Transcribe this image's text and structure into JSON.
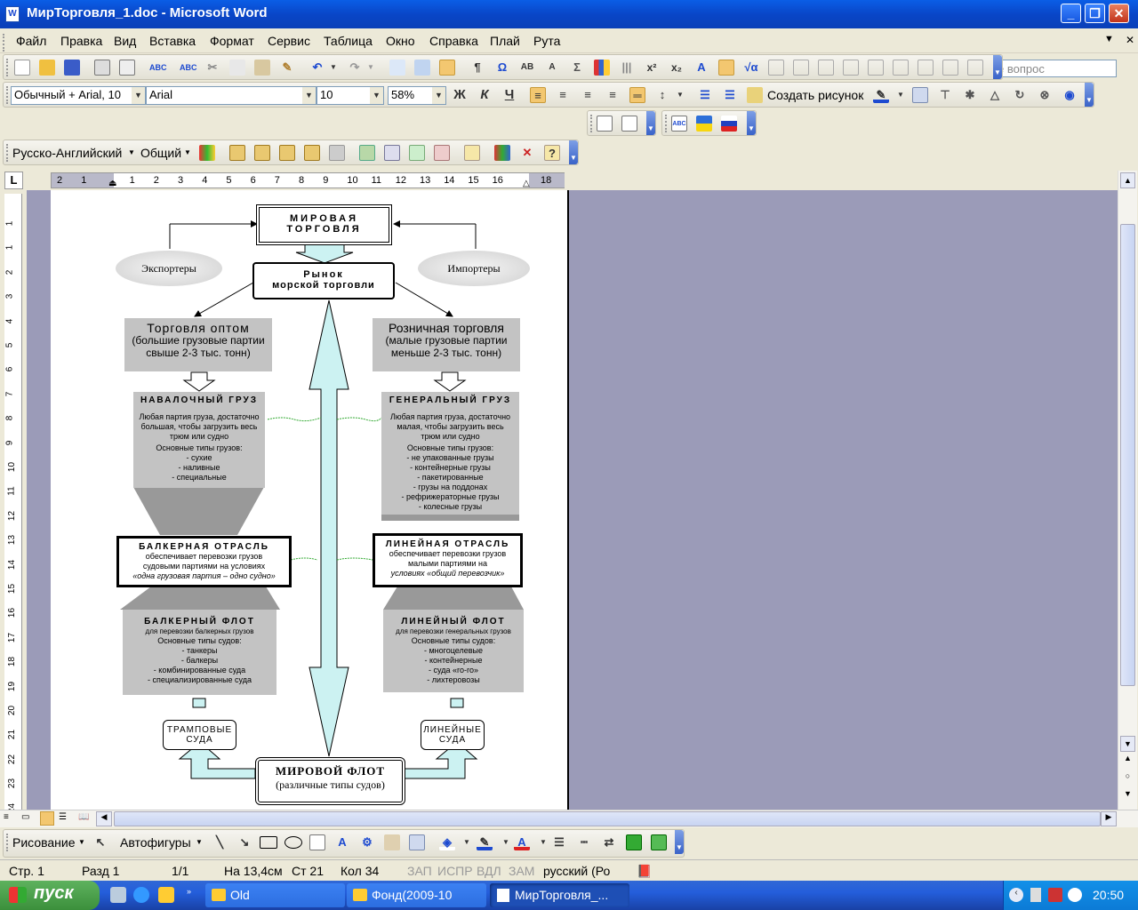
{
  "window": {
    "title": "МирТорговля_1.doc - Microsoft Word",
    "icon_label": "W"
  },
  "window_buttons": {
    "minimize": "_",
    "restore": "❐",
    "close": "✕"
  },
  "menu": [
    "Файл",
    "Правка",
    "Вид",
    "Вставка",
    "Формат",
    "Сервис",
    "Таблица",
    "Окно",
    "Справка",
    "Плай",
    "Рута"
  ],
  "help_box": {
    "placeholder": "Введите вопрос"
  },
  "menu_close_glyph": "✕",
  "toolbar_glyphs": {
    "pilcrow": "¶",
    "omega": "Ω",
    "sigma": "Σ",
    "sqrt": "√α"
  },
  "formatting": {
    "style": "Обычный + Arial, 10",
    "font": "Arial",
    "size": "10",
    "zoom": "58%",
    "bold": "Ж",
    "italic": "К",
    "underline": "Ч",
    "draw_picture": "Создать рисунок"
  },
  "translate_bar": {
    "direction": "Русско-Английский",
    "topic": "Общий"
  },
  "ruler": {
    "corner": "L",
    "h_ticks": [
      "2",
      "1",
      "",
      "1",
      "2",
      "3",
      "4",
      "5",
      "6",
      "7",
      "8",
      "9",
      "10",
      "11",
      "12",
      "13",
      "14",
      "15",
      "16",
      "",
      "18"
    ],
    "v_ticks": [
      "1",
      "1",
      "2",
      "3",
      "4",
      "5",
      "6",
      "7",
      "8",
      "9",
      "10",
      "11",
      "12",
      "13",
      "14",
      "15",
      "16",
      "17",
      "18",
      "19",
      "20",
      "21",
      "22",
      "23",
      "24"
    ]
  },
  "diagram": {
    "top": {
      "line1": "МИРОВАЯ",
      "line2": "ТОРГОВЛЯ"
    },
    "exporters": "Экспортеры",
    "importers": "Импортеры",
    "market": {
      "line1": "Рынок",
      "line2": "морской торговли"
    },
    "wholesale": {
      "title": "Торговля оптом",
      "line2": "(большие грузовые партии",
      "line3": "свыше 2-3 тыс. тонн)"
    },
    "retail": {
      "title": "Розничная торговля",
      "line2": "(малые грузовые партии",
      "line3": "меньше 2-3 тыс. тонн)"
    },
    "bulk_cargo": {
      "title": "НАВАЛОЧНЫЙ ГРУЗ",
      "desc1": "Любая партия груза, достаточно",
      "desc2": "большая, чтобы загрузить весь",
      "desc3": "трюм или судно",
      "types_title": "Основные типы грузов:",
      "types": [
        "- сухие",
        "- наливные",
        "- специальные"
      ]
    },
    "general_cargo": {
      "title": "ГЕНЕРАЛЬНЫЙ ГРУЗ",
      "desc1": "Любая партия груза, достаточно",
      "desc2": "малая, чтобы загрузить весь",
      "desc3": "трюм или судно",
      "types_title": "Основные типы грузов:",
      "types": [
        "- не упакованные грузы",
        "- контейнерные грузы",
        "- пакетированные",
        "- грузы на поддонах",
        "- рефрижераторные грузы",
        "- колесные грузы"
      ]
    },
    "bulk_sector": {
      "title": "БАЛКЕРНАЯ ОТРАСЛЬ",
      "line1": "обеспечивает перевозки грузов",
      "line2": "судовыми партиями на условиях",
      "line3": "«одна грузовая партия – одно судно»"
    },
    "liner_sector": {
      "title": "ЛИНЕЙНАЯ ОТРАСЛЬ",
      "line1": "обеспечивает перевозки грузов",
      "line2": "малыми партиями на",
      "line3": "условиях «общий перевозчик»"
    },
    "bulk_fleet": {
      "title": "БАЛКЕРНЫЙ ФЛОТ",
      "sub": "для перевозки балкерных грузов",
      "types_title": "Основные типы судов:",
      "types": [
        "- танкеры",
        "- балкеры",
        "- комбинированные суда",
        "- специализированные суда"
      ]
    },
    "liner_fleet": {
      "title": "ЛИНЕЙНЫЙ ФЛОТ",
      "sub": "для перевозки генеральных грузов",
      "types_title": "Основные типы судов:",
      "types": [
        "- многоцелевые",
        "- контейнерные",
        "- суда «ro-ro»",
        "- лихтеровозы"
      ]
    },
    "tramp": {
      "line1": "ТРАМПОВЫЕ",
      "line2": "СУДА"
    },
    "liner_ships": {
      "line1": "ЛИНЕЙНЫЕ",
      "line2": "СУДА"
    },
    "world_fleet": {
      "title": "МИРОВОЙ ФЛОТ",
      "sub": "(различные типы судов)"
    }
  },
  "drawing_bar": {
    "draw": "Рисование",
    "autoshapes": "Автофигуры"
  },
  "status": {
    "page": "Стр. 1",
    "section": "Разд 1",
    "pages": "1/1",
    "at": "На 13,4см",
    "line": "Ст 21",
    "col": "Кол 34",
    "rec": "ЗАП",
    "trk": "ИСПР",
    "ext": "ВДЛ",
    "ovr": "ЗАМ",
    "lang": "русский (Ро"
  },
  "taskbar": {
    "start": "пуск",
    "tasks": [
      "Old",
      "Фонд(2009-10",
      "МирТорговля_..."
    ],
    "clock": "20:50"
  },
  "colors": {
    "titlebar": "#0a4fd6",
    "page_bg": "#9b9bb8",
    "cyan_arrow": "#ccf2f2",
    "gray_box": "#c3c3c3"
  }
}
